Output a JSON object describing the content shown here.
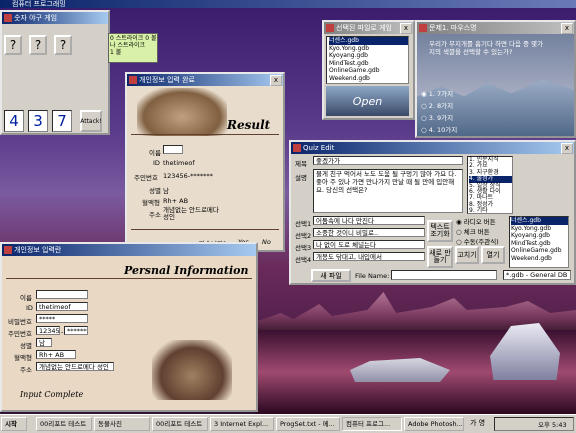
{
  "desktop": {
    "strip_title": "컴퓨터 프로그래밍"
  },
  "game": {
    "title": "숫자 야구 게임",
    "slots": [
      "?",
      "?",
      "?"
    ],
    "numbers": [
      "4",
      "3",
      "7"
    ],
    "attack_label": "Attack!",
    "memo": "0 스트라이크 0 볼\n나 스트라이크\n1 볼"
  },
  "result_win": {
    "title": "개인정보 입력 완료",
    "result_heading": "Result",
    "fields": [
      {
        "label": "이름",
        "value": ""
      },
      {
        "label": "ID",
        "value": "thetimeof"
      },
      {
        "label": "주민번호",
        "value": "123456-*******"
      },
      {
        "label": "성별",
        "value": "남"
      },
      {
        "label": "혈액형",
        "value": "Rh+ AB"
      },
      {
        "label": "주소",
        "value": "개념없는 안드로메다 성인"
      }
    ],
    "question": "맞습니까?",
    "yes": "Yes",
    "no": "No"
  },
  "info_win": {
    "title": "개인정보 입력란",
    "heading": "Persnal Information",
    "fields": [
      {
        "label": "이름",
        "value": ""
      },
      {
        "label": "ID",
        "value": "thetimeof"
      },
      {
        "label": "비밀번호",
        "value": "*****"
      },
      {
        "label": "주민번호",
        "value": "123456"
      },
      {
        "label": "주민번호2",
        "value": "*******"
      },
      {
        "label": "성별",
        "value": "남"
      },
      {
        "label": "혈액형",
        "value": "Rh+ AB"
      },
      {
        "label": "주소",
        "value": "개념없는 안드로메다 성인"
      }
    ],
    "complete": "Input Complete"
  },
  "db_list_win": {
    "title": "선택된 파일로 게임",
    "items": [
      "너센스.gdb",
      "Kyo.Yong.gdb",
      "Kyoyang.gdb",
      "MindTest.gdb",
      "OnlineGame.gdb",
      "Weekend.gdb"
    ],
    "open_label": "Open"
  },
  "quiz_win": {
    "title": "문제1. 마우스명",
    "question": "우리가 무지개를 흡기다 하면 다음 중 몇가지의 색깔을 선택할 수 있는가?",
    "options": [
      "1. 7가지",
      "2. 8가지",
      "3. 9가지",
      "4. 10가지"
    ]
  },
  "edit_win": {
    "title": "Quiz Edit",
    "subject_label": "제목",
    "subject_value": "좋겠가가",
    "desc_label": "설명",
    "desc_value": "물게 친구 먹어서 노도 도움 될 구멍기 많아 가요 다. 좋아 주 있나 가면 만나가지 만날 때 될 만에 입안해요. 당신의 선택은?",
    "side_list": [
      "1. 인문지식",
      "2. 가요",
      "3. 지구환경",
      "4. 물정가",
      "5. 일상 상식",
      "6. 생활 다이",
      "7. 마나트",
      "8. 정성가",
      "9. 기타"
    ],
    "choice_labels": [
      "선택1",
      "선택2",
      "선택3",
      "선택4"
    ],
    "choices": [
      "어둠속에 나다 만진다",
      "소중한 것이니 비밀로..",
      "나 없이 도로 체널는다",
      "개봉도 닦대고, 내입에서"
    ],
    "text_btn": "텍스트 조기화",
    "radio_opts": [
      "라디오 버튼",
      "체크 버튼",
      "수동(주관식)"
    ],
    "file_list": [
      "너센스.gdb",
      "Kyo.Yong.gdb",
      "Kyoyang.gdb",
      "MindTest.gdb",
      "OnlineGame.gdb",
      "Weekend.gdb"
    ],
    "new_file": "새 파일",
    "file_name_label": "File Name:",
    "make_btn": "새로 만들기",
    "fix_btn": "고치기",
    "open_btn": "열기",
    "filter": "*.gdb - General DB"
  },
  "taskbar": {
    "start": "시작",
    "items": [
      "00리포트 테스트",
      "동물사진",
      "00리포트 테스트",
      "3 Internet Expl...",
      "ProgSet.txt - 메...",
      "컴퓨터 프로그...",
      "Adobe Photosh..."
    ],
    "ime": "가 영",
    "clock": "오후 5:43"
  }
}
